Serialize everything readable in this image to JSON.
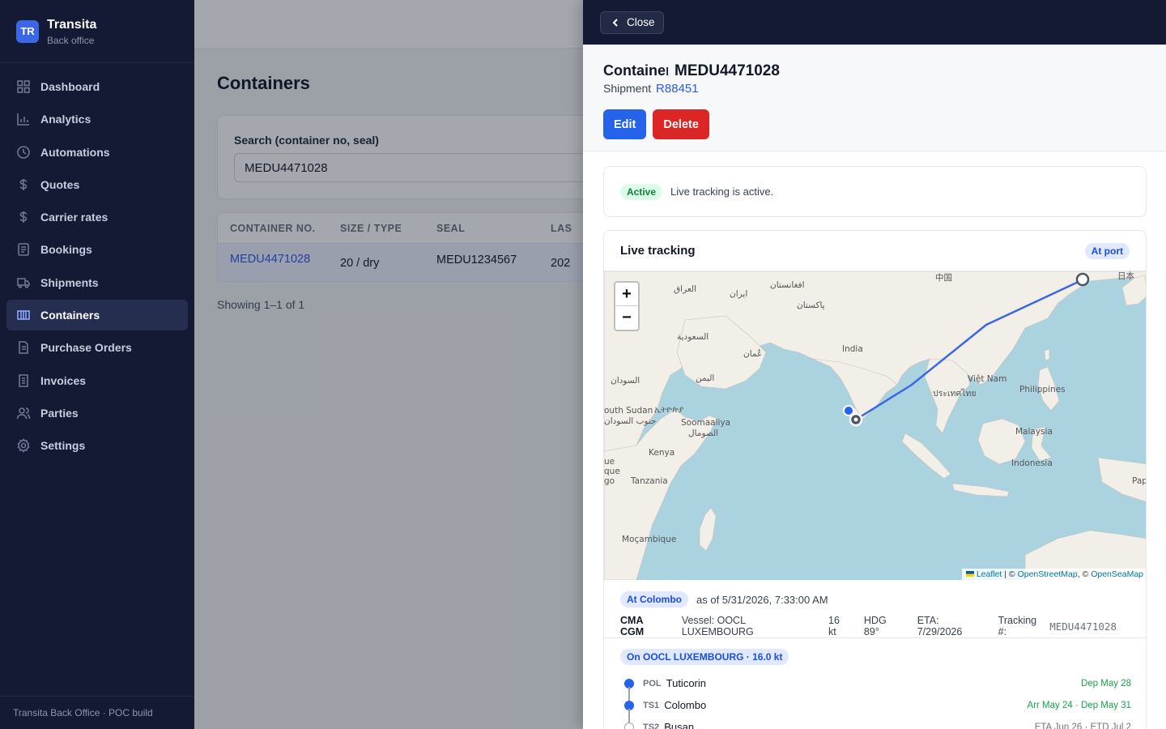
{
  "brand": {
    "logo": "TR",
    "name": "Transita",
    "sub": "Back office"
  },
  "nav": [
    {
      "label": "Dashboard",
      "icon": "grid-icon"
    },
    {
      "label": "Analytics",
      "icon": "bar-chart-icon"
    },
    {
      "label": "Automations",
      "icon": "clock-icon"
    },
    {
      "label": "Quotes",
      "icon": "dollar-icon"
    },
    {
      "label": "Carrier rates",
      "icon": "dollar-icon"
    },
    {
      "label": "Bookings",
      "icon": "document-icon"
    },
    {
      "label": "Shipments",
      "icon": "truck-icon"
    },
    {
      "label": "Containers",
      "icon": "container-icon",
      "active": true
    },
    {
      "label": "Purchase Orders",
      "icon": "file-icon"
    },
    {
      "label": "Invoices",
      "icon": "receipt-icon"
    },
    {
      "label": "Parties",
      "icon": "users-icon"
    },
    {
      "label": "Settings",
      "icon": "gear-icon"
    }
  ],
  "footer": "Transita Back Office · POC build",
  "page": {
    "title": "Containers",
    "search_label": "Search (container no, seal)",
    "search_value": "MEDU4471028",
    "columns": [
      "CONTAINER NO.",
      "SIZE / TYPE",
      "SEAL",
      "LAS"
    ],
    "row": {
      "container": "MEDU4471028",
      "size_type": "20 / dry",
      "seal": "MEDU1234567",
      "last": "202"
    },
    "showing": "Showing 1–1 of 1"
  },
  "drawer": {
    "close_label": "Close",
    "kind": "Container",
    "number": "MEDU4471028",
    "shipment_label": "Shipment",
    "shipment_id": "R88451",
    "edit_label": "Edit",
    "delete_label": "Delete",
    "status_pill": "Active",
    "status_text": "Live tracking is active.",
    "tracking_title": "Live tracking",
    "tracking_pill": "At port",
    "map": {
      "zoom_in": "+",
      "zoom_out": "−",
      "attrib_leaflet": "Leaflet",
      "attrib_sep": " | © ",
      "attrib_osm": "OpenStreetMap",
      "attrib_sep2": ", © ",
      "attrib_osea": "OpenSeaMap",
      "labels": [
        "中国",
        "日本",
        "العراق",
        "افغانستان",
        "ایران",
        "پاکستان",
        "السعودية",
        "عُمان",
        "India",
        "السودان",
        "اليمن",
        "Việt Nam",
        "ประเทศไทย",
        "Philippines",
        "outh Sudan",
        "جنوب السودان",
        "ኢትዮጵያ",
        "Soomaaliya",
        "الصومال",
        "Malaysia",
        "Kenya",
        "Indonesia",
        "ue",
        "que",
        "go",
        "Tanzania",
        "Pap",
        "Moçambique"
      ]
    },
    "position": {
      "pill": "At Colombo",
      "as_of": "as of 5/31/2026, 7:33:00 AM",
      "carrier": "CMA CGM",
      "vessel": "Vessel: OOCL LUXEMBOURG",
      "speed": "16 kt",
      "heading": "HDG 89°",
      "eta": "ETA: 7/29/2026",
      "tracking_label": "Tracking #:",
      "tracking_no": "MEDU4471028"
    },
    "legs_pill": "On OOCL LUXEMBOURG · 16.0 kt",
    "legs": [
      {
        "code": "POL",
        "port": "Tuticorin",
        "when": "Dep May 28"
      },
      {
        "code": "TS1",
        "port": "Colombo",
        "when": "Arr May 24 · Dep May 31"
      },
      {
        "code": "TS2",
        "port": "Busan",
        "when": "ETA Jun 26 · ETD Jul 2"
      }
    ],
    "colors": {
      "accent": "#2563eb",
      "danger": "#dc2626",
      "route": "#3b66e6"
    }
  }
}
